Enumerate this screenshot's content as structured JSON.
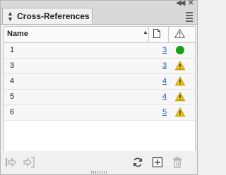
{
  "panel": {
    "title": "Cross-References"
  },
  "table": {
    "header": {
      "name": "Name"
    },
    "rows": [
      {
        "name": "1",
        "page": "3",
        "status": "ok"
      },
      {
        "name": "3",
        "page": "3",
        "status": "warning"
      },
      {
        "name": "4",
        "page": "4",
        "status": "warning"
      },
      {
        "name": "5",
        "page": "4",
        "status": "warning"
      },
      {
        "name": "6",
        "page": "5",
        "status": "warning"
      }
    ]
  },
  "colors": {
    "ok": "#16a01b",
    "warning": "#f2c40f",
    "link": "#2060c0"
  },
  "footer": {
    "icons": [
      "go-to-source-icon",
      "go-to-destination-icon",
      "update-icon",
      "new-cross-reference-icon",
      "delete-icon"
    ]
  }
}
